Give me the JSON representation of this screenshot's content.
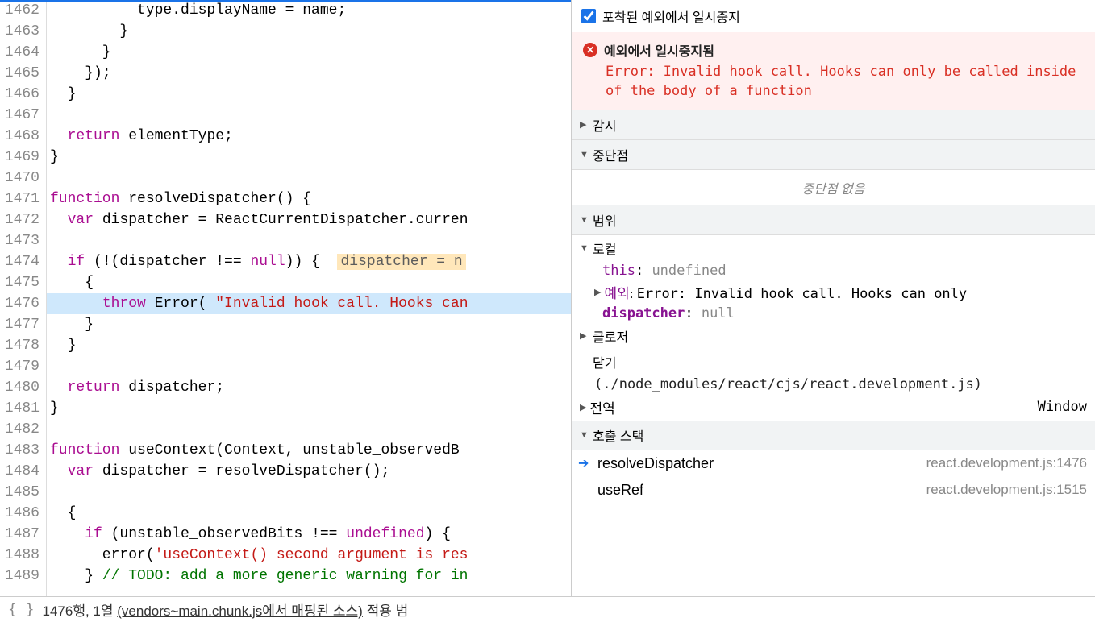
{
  "gutter_start": 1462,
  "gutter_end": 1489,
  "highlighted_line": 1476,
  "code_lines": [
    {
      "n": 1462,
      "segs": [
        {
          "t": "          type.displayName = name;",
          "c": ""
        }
      ]
    },
    {
      "n": 1463,
      "segs": [
        {
          "t": "        }",
          "c": ""
        }
      ]
    },
    {
      "n": 1464,
      "segs": [
        {
          "t": "      }",
          "c": ""
        }
      ]
    },
    {
      "n": 1465,
      "segs": [
        {
          "t": "    });",
          "c": ""
        }
      ]
    },
    {
      "n": 1466,
      "segs": [
        {
          "t": "  }",
          "c": ""
        }
      ]
    },
    {
      "n": 1467,
      "segs": [
        {
          "t": "",
          "c": ""
        }
      ]
    },
    {
      "n": 1468,
      "segs": [
        {
          "t": "  ",
          "c": ""
        },
        {
          "t": "return",
          "c": "kw"
        },
        {
          "t": " elementType;",
          "c": ""
        }
      ]
    },
    {
      "n": 1469,
      "segs": [
        {
          "t": "}",
          "c": ""
        }
      ]
    },
    {
      "n": 1470,
      "segs": [
        {
          "t": "",
          "c": ""
        }
      ]
    },
    {
      "n": 1471,
      "segs": [
        {
          "t": "function",
          "c": "kw"
        },
        {
          "t": " resolveDispatcher() {",
          "c": ""
        }
      ]
    },
    {
      "n": 1472,
      "segs": [
        {
          "t": "  ",
          "c": ""
        },
        {
          "t": "var",
          "c": "kw"
        },
        {
          "t": " dispatcher = ReactCurrentDispatcher.curren",
          "c": ""
        }
      ]
    },
    {
      "n": 1473,
      "segs": [
        {
          "t": "",
          "c": ""
        }
      ]
    },
    {
      "n": 1474,
      "segs": [
        {
          "t": "  ",
          "c": ""
        },
        {
          "t": "if",
          "c": "kw"
        },
        {
          "t": " (!(dispatcher !== ",
          "c": ""
        },
        {
          "t": "null",
          "c": "kw"
        },
        {
          "t": ")) {  ",
          "c": ""
        },
        {
          "t": "dispatcher = n",
          "c": "inline-hint"
        }
      ]
    },
    {
      "n": 1475,
      "segs": [
        {
          "t": "    {",
          "c": ""
        }
      ]
    },
    {
      "n": 1476,
      "hl": true,
      "segs": [
        {
          "t": "      ",
          "c": ""
        },
        {
          "t": "throw",
          "c": "kw"
        },
        {
          "t": " Error( ",
          "c": ""
        },
        {
          "t": "\"Invalid hook call. Hooks can",
          "c": "str"
        }
      ]
    },
    {
      "n": 1477,
      "segs": [
        {
          "t": "    }",
          "c": ""
        }
      ]
    },
    {
      "n": 1478,
      "segs": [
        {
          "t": "  }",
          "c": ""
        }
      ]
    },
    {
      "n": 1479,
      "segs": [
        {
          "t": "",
          "c": ""
        }
      ]
    },
    {
      "n": 1480,
      "segs": [
        {
          "t": "  ",
          "c": ""
        },
        {
          "t": "return",
          "c": "kw"
        },
        {
          "t": " dispatcher;",
          "c": ""
        }
      ]
    },
    {
      "n": 1481,
      "segs": [
        {
          "t": "}",
          "c": ""
        }
      ]
    },
    {
      "n": 1482,
      "segs": [
        {
          "t": "",
          "c": ""
        }
      ]
    },
    {
      "n": 1483,
      "segs": [
        {
          "t": "function",
          "c": "kw"
        },
        {
          "t": " useContext(Context, unstable_observedB",
          "c": ""
        }
      ]
    },
    {
      "n": 1484,
      "segs": [
        {
          "t": "  ",
          "c": ""
        },
        {
          "t": "var",
          "c": "kw"
        },
        {
          "t": " dispatcher = resolveDispatcher();",
          "c": ""
        }
      ]
    },
    {
      "n": 1485,
      "segs": [
        {
          "t": "",
          "c": ""
        }
      ]
    },
    {
      "n": 1486,
      "segs": [
        {
          "t": "  {",
          "c": ""
        }
      ]
    },
    {
      "n": 1487,
      "segs": [
        {
          "t": "    ",
          "c": ""
        },
        {
          "t": "if",
          "c": "kw"
        },
        {
          "t": " (unstable_observedBits !== ",
          "c": ""
        },
        {
          "t": "undefined",
          "c": "kw"
        },
        {
          "t": ") {",
          "c": ""
        }
      ]
    },
    {
      "n": 1488,
      "segs": [
        {
          "t": "      error(",
          "c": ""
        },
        {
          "t": "'useContext() second argument is res",
          "c": "str"
        }
      ]
    },
    {
      "n": 1489,
      "segs": [
        {
          "t": "    } ",
          "c": ""
        },
        {
          "t": "// TODO: add a more generic warning for in",
          "c": "comment"
        }
      ]
    }
  ],
  "debug": {
    "pause_on_caught_label": "포착된 예외에서 일시중지",
    "paused_title": "예외에서 일시중지됨",
    "paused_message": "Error: Invalid hook call. Hooks can only be called inside of the body of a function",
    "watch_label": "감시",
    "breakpoints_label": "중단점",
    "breakpoints_empty": "중단점 없음",
    "scope_label": "범위",
    "local_label": "로컬",
    "this_key": "this",
    "this_val": "undefined",
    "exception_key": "예외",
    "exception_val": "Error: Invalid hook call. Hooks can only ",
    "dispatcher_key": "dispatcher",
    "dispatcher_val": "null",
    "closure_label": "클로저",
    "closure2_label": "닫기",
    "closure2_path": "(./node_modules/react/cjs/react.development.js)",
    "global_label": "전역",
    "global_val": "Window",
    "callstack_label": "호출 스택",
    "callstack": [
      {
        "fn": "resolveDispatcher",
        "loc": "react.development.js:1476",
        "active": true
      },
      {
        "fn": "useRef",
        "loc": "react.development.js:1515",
        "active": false
      }
    ]
  },
  "status": {
    "line_col": "1476행, 1열",
    "mapped": "(vendors~main.chunk.js에서 매핑된 소스)",
    "coverage": "적용 범"
  }
}
